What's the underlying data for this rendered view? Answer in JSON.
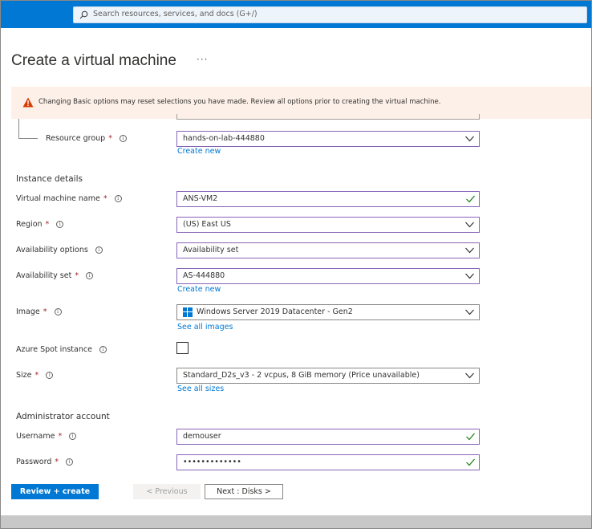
{
  "header": {
    "search_placeholder": "Search resources, services, and docs (G+/)"
  },
  "page": {
    "title": "Create a virtual machine",
    "more": "···"
  },
  "warning": {
    "text": "Changing Basic options may reset selections you have made. Review all options prior to creating the virtual machine."
  },
  "form": {
    "resource_group": {
      "label": "Resource group",
      "required": "*",
      "value": "hands-on-lab-444880",
      "link": "Create new"
    },
    "instance_details": "Instance details",
    "vm_name": {
      "label": "Virtual machine name",
      "required": "*",
      "value": "ANS-VM2"
    },
    "region": {
      "label": "Region",
      "required": "*",
      "value": "(US) East US"
    },
    "availability_options": {
      "label": "Availability options",
      "value": "Availability set"
    },
    "availability_set": {
      "label": "Availability set",
      "required": "*",
      "value": "AS-444880",
      "link": "Create new"
    },
    "image": {
      "label": "Image",
      "required": "*",
      "value": "Windows Server 2019 Datacenter - Gen2",
      "link": "See all images"
    },
    "spot": {
      "label": "Azure Spot instance",
      "checked": false
    },
    "size": {
      "label": "Size",
      "required": "*",
      "value": "Standard_D2s_v3 - 2 vcpus, 8 GiB memory (Price unavailable)",
      "link": "See all sizes"
    },
    "admin_account": "Administrator account",
    "username": {
      "label": "Username",
      "required": "*",
      "value": "demouser"
    },
    "password": {
      "label": "Password",
      "required": "*",
      "value": "•••••••••••••"
    }
  },
  "footer": {
    "review_create": "Review + create",
    "previous": "< Previous",
    "next": "Next : Disks >"
  },
  "colors": {
    "brand": "#0078d4",
    "focus_border": "#8764b8",
    "valid": "#107c10",
    "warning_bg": "#fdf0e8",
    "required": "#a4262c"
  }
}
